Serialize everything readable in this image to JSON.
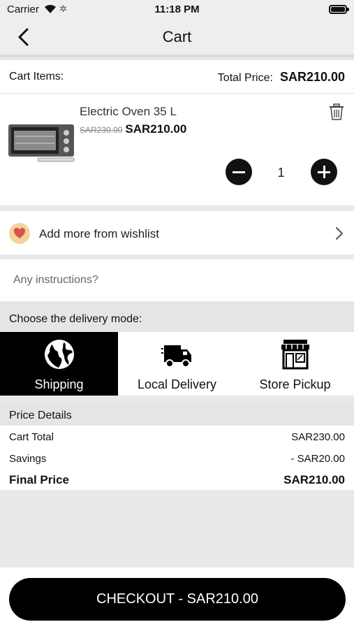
{
  "status_bar": {
    "carrier": "Carrier",
    "time": "11:18 PM"
  },
  "nav": {
    "title": "Cart"
  },
  "cart_header": {
    "items_label": "Cart Items:",
    "total_label": "Total Price:",
    "total_value": "SAR210.00"
  },
  "cart_item": {
    "name": "Electric Oven 35 L",
    "old_price": "SAR230.00",
    "new_price": "SAR210.00",
    "quantity": "1"
  },
  "wishlist": {
    "label": "Add more from wishlist"
  },
  "instructions": {
    "placeholder": "Any instructions?"
  },
  "delivery": {
    "label": "Choose the delivery mode:",
    "modes": [
      {
        "label": "Shipping",
        "icon": "globe-icon",
        "selected": true
      },
      {
        "label": "Local Delivery",
        "icon": "truck-icon",
        "selected": false
      },
      {
        "label": "Store Pickup",
        "icon": "store-icon",
        "selected": false
      }
    ]
  },
  "price_details": {
    "title": "Price Details",
    "rows": [
      {
        "label": "Cart Total",
        "value": "SAR230.00"
      },
      {
        "label": "Savings",
        "value": "- SAR20.00"
      },
      {
        "label": "Final Price",
        "value": "SAR210.00"
      }
    ]
  },
  "checkout": {
    "label": "CHECKOUT - SAR210.00"
  },
  "colors": {
    "accent": "#000000",
    "background": "#e9e9e9",
    "wishlist_badge": "#f5d39a",
    "heart": "#d9534f"
  }
}
